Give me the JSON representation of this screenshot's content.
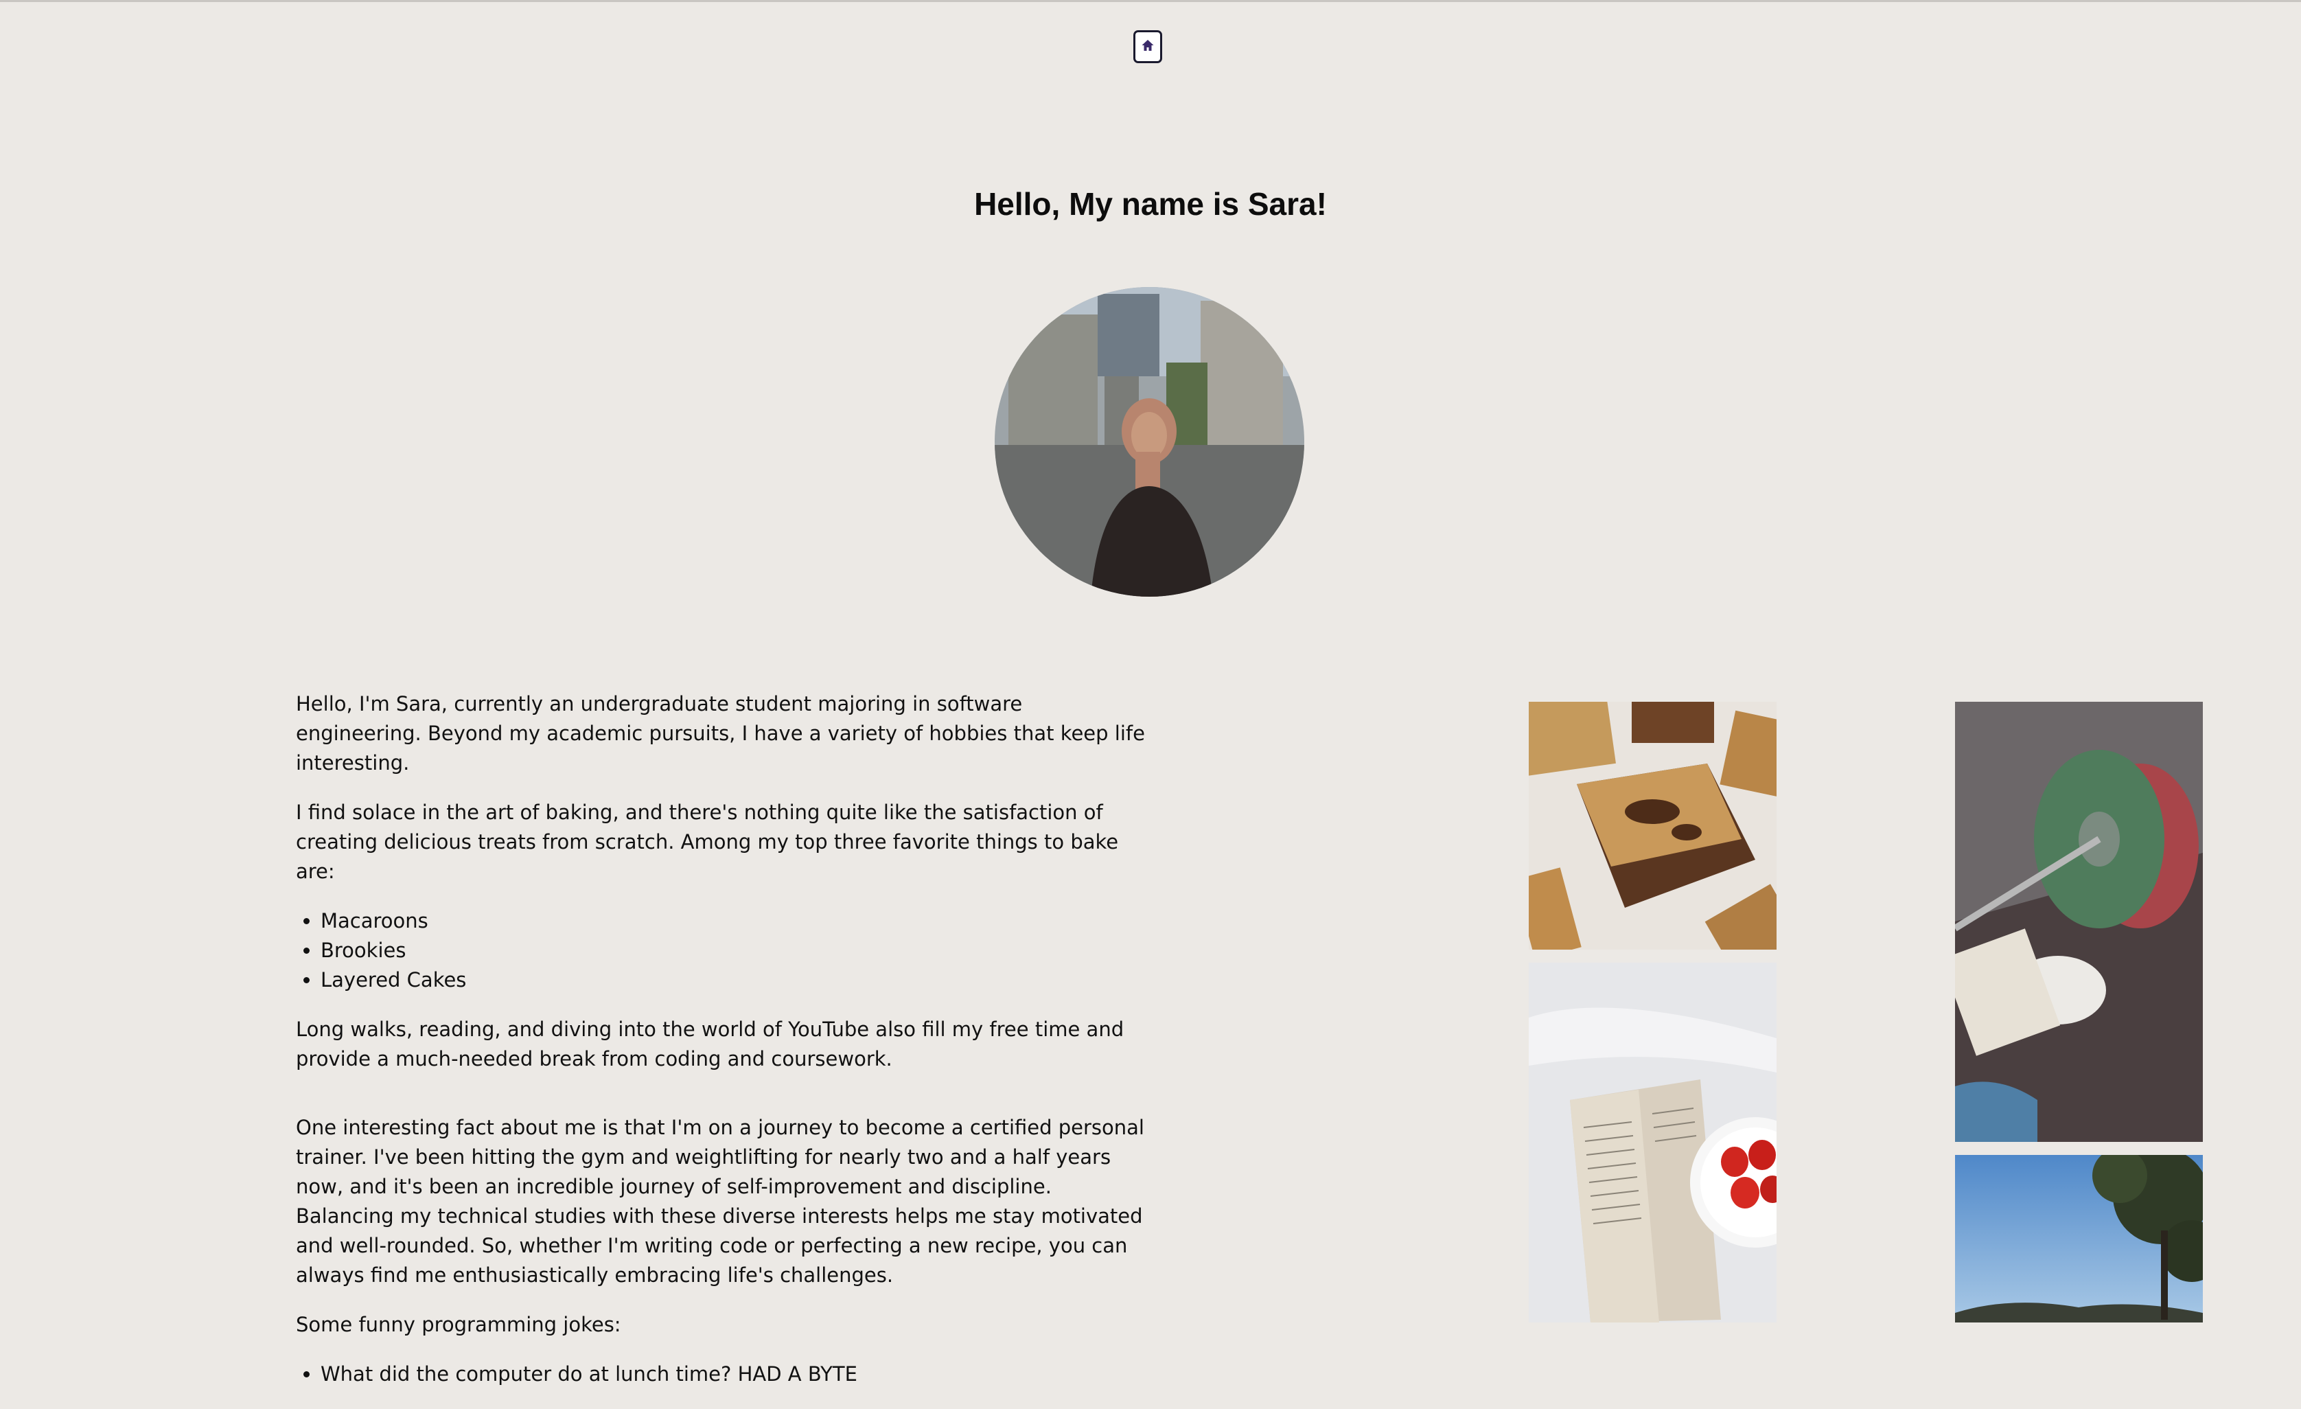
{
  "nav": {
    "home_icon": "home-icon"
  },
  "page": {
    "title": "Hello, My name is Sara!"
  },
  "about": {
    "intro": "Hello, I'm Sara, currently an undergraduate student majoring in software engineering. Beyond my academic pursuits, I have a variety of hobbies that keep life interesting.",
    "baking": "I find solace in the art of baking, and there's nothing quite like the satisfaction of creating delicious treats from scratch. Among my top three favorite things to bake are:",
    "bake_list": [
      "Macaroons",
      "Brookies",
      "Layered Cakes"
    ],
    "free_time": "Long walks, reading, and diving into the world of YouTube also fill my free time and provide a much-needed break from coding and coursework.",
    "fact": "One interesting fact about me is that I'm on a journey to become a certified personal trainer. I've been hitting the gym and weightlifting for nearly two and a half years now, and it's been an incredible journey of self-improvement and discipline. Balancing my technical studies with these diverse interests helps me stay motivated and well-rounded. So, whether I'm writing code or perfecting a new recipe, you can always find me enthusiastically embracing life's challenges.",
    "jokes_heading": "Some funny programming jokes:",
    "jokes": [
      "What did the computer do at lunch time? HAD A BYTE"
    ]
  },
  "colors": {
    "background": "#ece9e5",
    "text": "#111111",
    "button_border": "#1a1a2e"
  }
}
